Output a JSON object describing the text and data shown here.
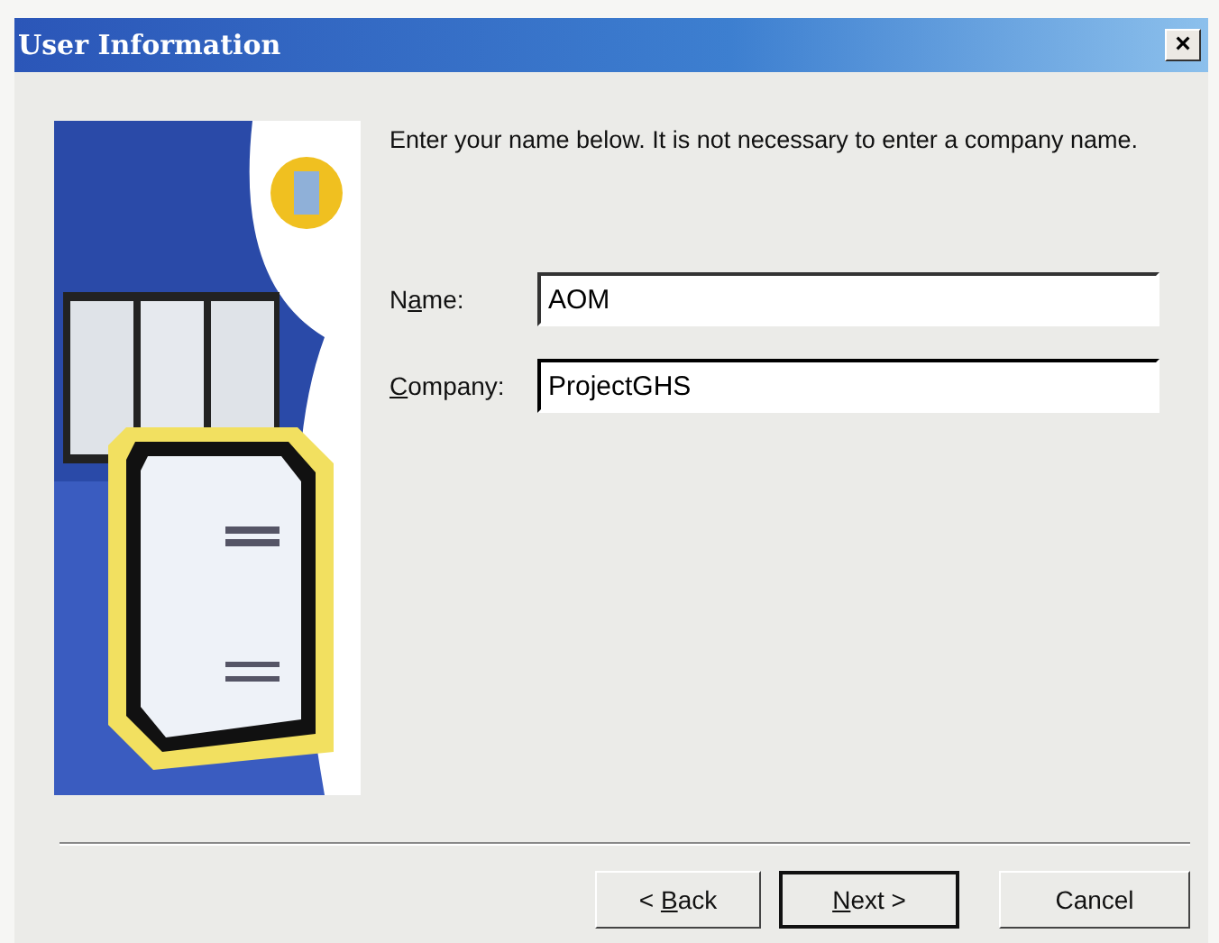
{
  "window": {
    "title": "User Information",
    "close": "×"
  },
  "instructions": "Enter your name below.  It is not necessary to enter a company name.",
  "fields": [
    {
      "label": {
        "pre": "N",
        "key": "a",
        "post": "me:"
      },
      "value": "AOM",
      "focused": false
    },
    {
      "label": {
        "key": "C",
        "post": "ompany:"
      },
      "value": "ProjectGHS",
      "focused": true
    }
  ],
  "buttons": [
    {
      "label": {
        "pre": "< ",
        "key": "B",
        "post": "ack"
      },
      "default": false
    },
    {
      "label": {
        "key": "N",
        "post": "ext >"
      },
      "default": true
    },
    {
      "label": {
        "pre": "Cancel"
      },
      "default": false
    }
  ]
}
